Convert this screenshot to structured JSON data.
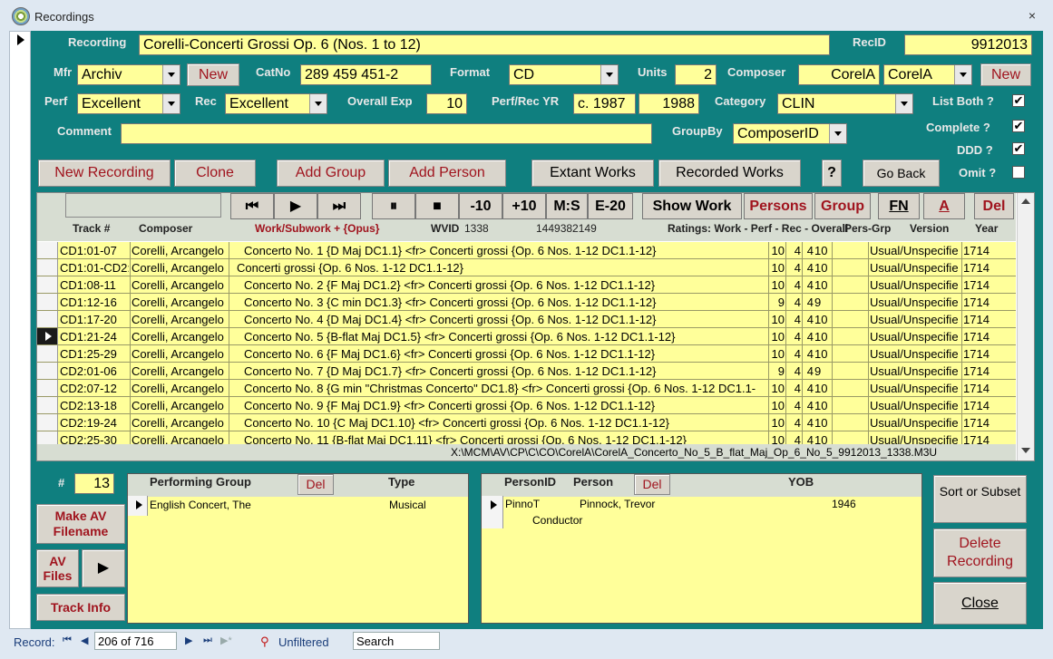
{
  "window": {
    "title": "Recordings",
    "close": "×"
  },
  "form": {
    "recording_label": "Recording",
    "recording_value": "Corelli-Concerti Grossi Op. 6 (Nos. 1 to 12)",
    "recid_label": "RecID",
    "recid_value": "9912013",
    "mfr_label": "Mfr",
    "mfr_value": "Archiv",
    "mfr_new": "New",
    "catno_label": "CatNo",
    "catno_value": "289 459 451-2",
    "format_label": "Format",
    "format_value": "CD",
    "units_label": "Units",
    "units_value": "2",
    "composer_label": "Composer",
    "composer_value": "CorelA",
    "composer_combo": "CorelA",
    "composer_new": "New",
    "perf_label": "Perf",
    "perf_value": "Excellent",
    "rec_label": "Rec",
    "rec_value": "Excellent",
    "overall_label": "Overall Exp",
    "overall_value": "10",
    "perfrec_label": "Perf/Rec YR",
    "perf_yr": "c. 1987",
    "rec_yr": "1988",
    "category_label": "Category",
    "category_value": "CLIN",
    "listboth_label": "List Both ?",
    "listboth_checked": "✔",
    "complete_label": "Complete ?",
    "complete_checked": "✔",
    "ddd_label": "DDD ?",
    "ddd_checked": "✔",
    "omit_label": "Omit ?",
    "comment_label": "Comment",
    "comment_value": "",
    "groupby_label": "GroupBy",
    "groupby_value": "ComposerID"
  },
  "buttons": {
    "new_recording": "New Recording",
    "clone": "Clone",
    "add_group": "Add Group",
    "add_person": "Add Person",
    "extant_works": "Extant Works",
    "recorded_works": "Recorded Works",
    "help": "?",
    "go_back": "Go Back"
  },
  "player": {
    "search_value": "",
    "first": "⏮",
    "play": "▶",
    "last": "⏭",
    "pause": "⏸",
    "stop": "■",
    "minus10": "-10",
    "plus10": "+10",
    "ms": "M:S",
    "e20": "E-20",
    "show_work": "Show Work",
    "persons": "Persons",
    "group": "Group",
    "fn": "FN",
    "a": "A",
    "del": "Del"
  },
  "tracks_header": {
    "track": "Track #",
    "composer": "Composer",
    "work": "Work/Subwork + {Opus}",
    "wvid": "WVID",
    "wvid_value": "1338",
    "id_value": "1449382149",
    "ratings": "Ratings: Work - Perf - Rec - Overall",
    "persgrp": "Pers-Grp",
    "version": "Version",
    "year": "Year"
  },
  "tracks": [
    {
      "track": "CD1:01-07",
      "composer": "Corelli, Arcangelo",
      "work": "Concerto No. 1 {D Maj DC1.1} <fr> Concerti grossi {Op. 6 Nos. 1-12 DC1.1-12}",
      "w": "10",
      "p": "4",
      "r": "4",
      "o": "10",
      "version": "Usual/Unspecifie",
      "year": "1714",
      "indent": "1"
    },
    {
      "track": "CD1:01-CD2:",
      "composer": "Corelli, Arcangelo",
      "work": "Concerti grossi {Op. 6 Nos. 1-12 DC1.1-12}",
      "w": "10",
      "p": "4",
      "r": "4",
      "o": "10",
      "version": "Usual/Unspecifie",
      "year": "1714",
      "indent": "0"
    },
    {
      "track": "CD1:08-11",
      "composer": "Corelli, Arcangelo",
      "work": "Concerto No. 2 {F Maj DC1.2} <fr> Concerti grossi {Op. 6 Nos. 1-12 DC1.1-12}",
      "w": "10",
      "p": "4",
      "r": "4",
      "o": "10",
      "version": "Usual/Unspecifie",
      "year": "1714",
      "indent": "1"
    },
    {
      "track": "CD1:12-16",
      "composer": "Corelli, Arcangelo",
      "work": "Concerto No. 3 {C min DC1.3} <fr> Concerti grossi {Op. 6 Nos. 1-12 DC1.1-12}",
      "w": "9",
      "p": "4",
      "r": "4",
      "o": "9",
      "version": "Usual/Unspecifie",
      "year": "1714",
      "indent": "1"
    },
    {
      "track": "CD1:17-20",
      "composer": "Corelli, Arcangelo",
      "work": "Concerto No. 4 {D Maj DC1.4} <fr> Concerti grossi {Op. 6 Nos. 1-12 DC1.1-12}",
      "w": "10",
      "p": "4",
      "r": "4",
      "o": "10",
      "version": "Usual/Unspecifie",
      "year": "1714",
      "indent": "1"
    },
    {
      "track": "CD1:21-24",
      "composer": "Corelli, Arcangelo",
      "work": "Concerto No. 5 {B-flat Maj DC1.5} <fr> Concerti grossi {Op. 6 Nos. 1-12 DC1.1-12}",
      "w": "10",
      "p": "4",
      "r": "4",
      "o": "10",
      "version": "Usual/Unspecifie",
      "year": "1714",
      "indent": "1"
    },
    {
      "track": "CD1:25-29",
      "composer": "Corelli, Arcangelo",
      "work": "Concerto No. 6 {F Maj DC1.6} <fr> Concerti grossi {Op. 6 Nos. 1-12 DC1.1-12}",
      "w": "10",
      "p": "4",
      "r": "4",
      "o": "10",
      "version": "Usual/Unspecifie",
      "year": "1714",
      "indent": "1"
    },
    {
      "track": "CD2:01-06",
      "composer": "Corelli, Arcangelo",
      "work": "Concerto No. 7 {D Maj DC1.7} <fr> Concerti grossi {Op. 6 Nos. 1-12 DC1.1-12}",
      "w": "9",
      "p": "4",
      "r": "4",
      "o": "9",
      "version": "Usual/Unspecifie",
      "year": "1714",
      "indent": "1"
    },
    {
      "track": "CD2:07-12",
      "composer": "Corelli, Arcangelo",
      "work": "Concerto No. 8 {G min \"Christmas Concerto\" DC1.8} <fr> Concerti grossi {Op. 6 Nos. 1-12 DC1.1-",
      "w": "10",
      "p": "4",
      "r": "4",
      "o": "10",
      "version": "Usual/Unspecifie",
      "year": "1714",
      "indent": "1"
    },
    {
      "track": "CD2:13-18",
      "composer": "Corelli, Arcangelo",
      "work": "Concerto No. 9 {F Maj DC1.9} <fr> Concerti grossi {Op. 6 Nos. 1-12 DC1.1-12}",
      "w": "10",
      "p": "4",
      "r": "4",
      "o": "10",
      "version": "Usual/Unspecifie",
      "year": "1714",
      "indent": "1"
    },
    {
      "track": "CD2:19-24",
      "composer": "Corelli, Arcangelo",
      "work": "Concerto No. 10 {C Maj DC1.10} <fr> Concerti grossi {Op. 6 Nos. 1-12 DC1.1-12}",
      "w": "10",
      "p": "4",
      "r": "4",
      "o": "10",
      "version": "Usual/Unspecifie",
      "year": "1714",
      "indent": "1"
    },
    {
      "track": "CD2:25-30",
      "composer": "Corelli, Arcangelo",
      "work": "Concerto No. 11 {B-flat Maj DC1.11} <fr> Concerti grossi {Op. 6 Nos. 1-12 DC1.1-12}",
      "w": "10",
      "p": "4",
      "r": "4",
      "o": "10",
      "version": "Usual/Unspecifie",
      "year": "1714",
      "indent": "1"
    }
  ],
  "path": "X:\\MCM\\AV\\CP\\C\\CO\\CorelA\\CorelA_Concerto_No_5_B_flat_Maj_Op_6_No_5_9912013_1338.M3U",
  "bottom": {
    "count_label": "#",
    "count_value": "13",
    "make_av": "Make AV Filename",
    "av_files": "AV Files",
    "av_arrow": "▶",
    "track_info": "Track Info",
    "pg_label": "Performing Group",
    "pg_del": "Del",
    "type_label": "Type",
    "pg_name": "English Concert, The",
    "pg_type": "Musical",
    "personid_label": "PersonID",
    "person_label": "Person",
    "person_del": "Del",
    "yob_label": "YOB",
    "person_id": "PinnoT",
    "person_name": "Pinnock, Trevor",
    "person_yob": "1946",
    "person_role": "Conductor",
    "sort_subset": "Sort or Subset",
    "delete_recording": "Delete Recording",
    "close": "Close"
  },
  "nav": {
    "record_label": "Record:",
    "position": "206 of 716",
    "filter": "Unfiltered",
    "search": "Search"
  }
}
